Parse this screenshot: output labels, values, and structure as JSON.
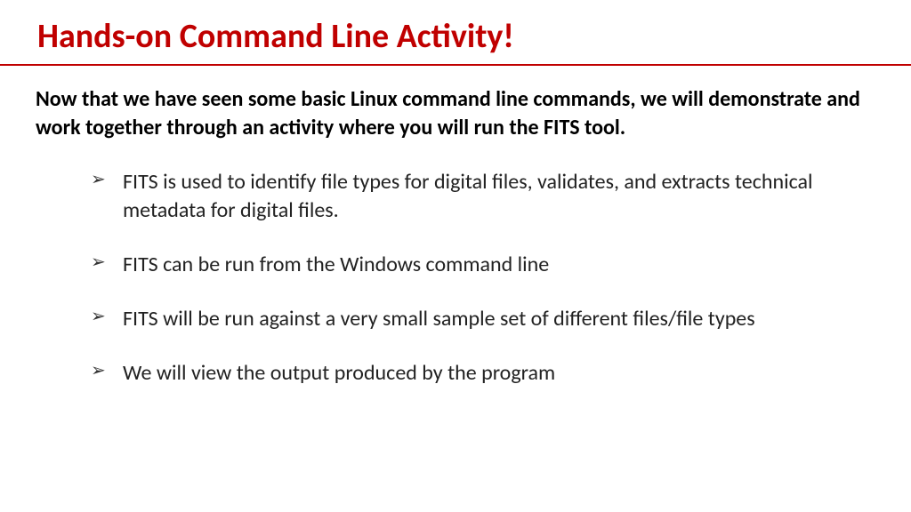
{
  "slide": {
    "title": "Hands-on Command Line Activity!",
    "intro": "Now that we have seen some basic Linux command line commands, we will demonstrate and work together through an activity where you will run the FITS tool.",
    "bullets": [
      "FITS is used to identify file types for digital files, validates, and extracts technical metadata for digital files.",
      "FITS can be run from the Windows command line",
      "FITS will be run against a very small sample set of different files/file types",
      "We will view the output produced by the program"
    ]
  }
}
